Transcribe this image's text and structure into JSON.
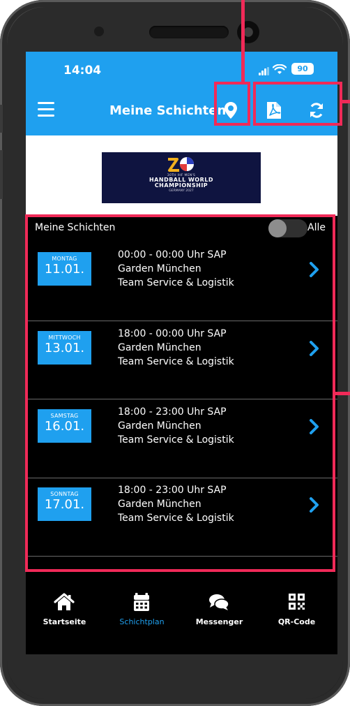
{
  "status_bar": {
    "time": "14:04",
    "battery": "90"
  },
  "app_bar": {
    "title": "Meine Schichten",
    "icons": [
      "menu-icon",
      "location-pin-icon",
      "pdf-icon",
      "sync-icon"
    ]
  },
  "logo": {
    "line1": "30TH IHF MEN'S",
    "line2": "HANDBALL WORLD",
    "line3": "CHAMPIONSHIP",
    "line4": "GERMANY 2027"
  },
  "list_header": {
    "label": "Meine Schichten",
    "toggle_label": "Alle",
    "toggle_on": false
  },
  "shifts": [
    {
      "weekday": "MONTAG",
      "date": "11.01.",
      "line1": "00:00 - 00:00 Uhr SAP",
      "line2": "Garden München",
      "line3": "Team Service & Logistik"
    },
    {
      "weekday": "MITTWOCH",
      "date": "13.01.",
      "line1": "18:00 - 00:00 Uhr SAP",
      "line2": "Garden München",
      "line3": "Team Service & Logistik"
    },
    {
      "weekday": "SAMSTAG",
      "date": "16.01.",
      "line1": "18:00 - 23:00 Uhr SAP",
      "line2": "Garden München",
      "line3": "Team Service & Logistik"
    },
    {
      "weekday": "SONNTAG",
      "date": "17.01.",
      "line1": "18:00 - 23:00 Uhr SAP",
      "line2": "Garden München",
      "line3": "Team Service & Logistik"
    }
  ],
  "bottom_nav": [
    {
      "label": "Startseite",
      "icon": "home-icon",
      "active": false
    },
    {
      "label": "Schichtplan",
      "icon": "calendar-icon",
      "active": true
    },
    {
      "label": "Messenger",
      "icon": "chat-bubbles-icon",
      "active": false
    },
    {
      "label": "QR-Code",
      "icon": "qr-code-icon",
      "active": false
    }
  ],
  "colors": {
    "accent": "#1fa0ef",
    "highlight": "#f02a58",
    "screen_bg": "#000000"
  }
}
